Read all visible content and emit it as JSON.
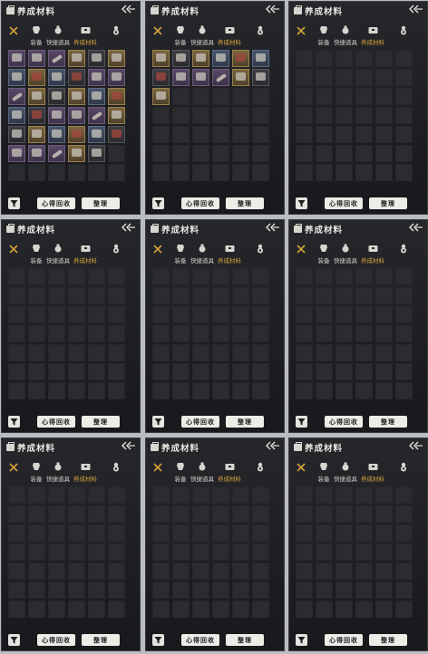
{
  "title": "养成材料",
  "tabs": [
    "装备",
    "快捷道具",
    "养成材料"
  ],
  "buttons": {
    "recycle": "心得回收",
    "sort": "整理"
  },
  "colors": {
    "active_tab": "#d4a13b",
    "panel_bg": "#1d1e21",
    "slot": "#2b2c30"
  },
  "icons": {
    "title": "bag-icon",
    "back": "back-arrow-icon",
    "close": "close-icon",
    "filter": "filter-icon",
    "tab_equipment": "armor-icon",
    "tab_quick": "pouch-icon",
    "tab_material": "chest-icon",
    "extra": "gourd-icon"
  },
  "panels": [
    {
      "id": "p1",
      "items": 35
    },
    {
      "id": "p2",
      "items": 13
    },
    {
      "id": "p3",
      "items": 0
    },
    {
      "id": "p4",
      "items": 0
    },
    {
      "id": "p5",
      "items": 0
    },
    {
      "id": "p6",
      "items": 0
    },
    {
      "id": "p7",
      "items": 0
    },
    {
      "id": "p8",
      "items": 0
    },
    {
      "id": "p9",
      "items": 0
    }
  ]
}
